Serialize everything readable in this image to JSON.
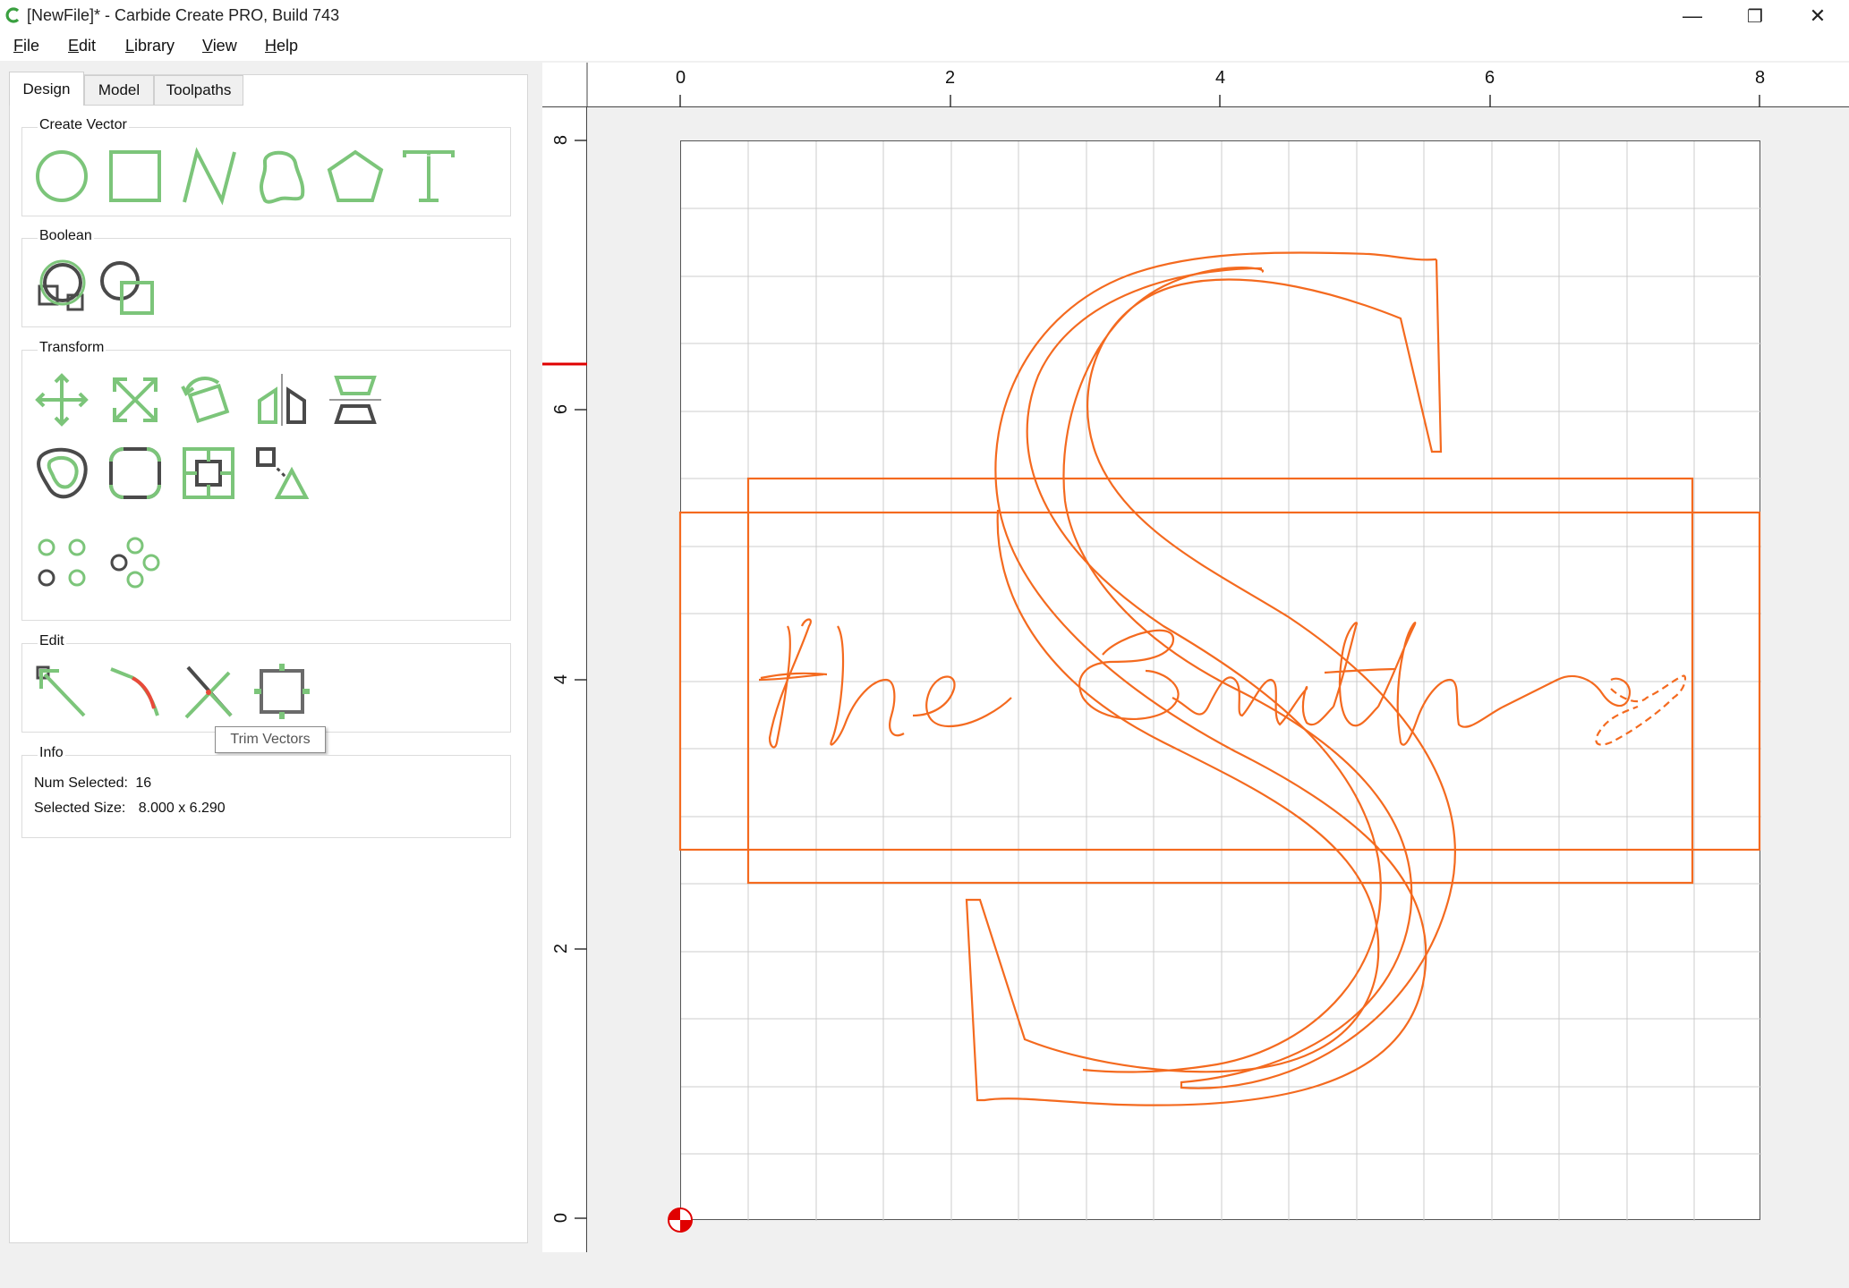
{
  "window": {
    "title": "[NewFile]* - Carbide Create PRO, Build 743",
    "controls": [
      "—",
      "❐",
      "✕"
    ]
  },
  "menu": [
    {
      "label": "File",
      "key": "F"
    },
    {
      "label": "Edit",
      "key": "E"
    },
    {
      "label": "Library",
      "key": "L"
    },
    {
      "label": "View",
      "key": "V"
    },
    {
      "label": "Help",
      "key": "H"
    }
  ],
  "tabs": [
    "Design",
    "Model",
    "Toolpaths"
  ],
  "groups": {
    "create_vector": {
      "title": "Create Vector",
      "tools": [
        "circle-icon",
        "rectangle-icon",
        "polyline-icon",
        "curve-icon",
        "polygon-icon",
        "text-icon"
      ]
    },
    "boolean": {
      "title": "Boolean",
      "tools": [
        "join-vectors-icon",
        "offset-vector-icon"
      ]
    },
    "transform": {
      "title": "Transform",
      "tools": [
        "move-icon",
        "scale-icon",
        "rotate-icon",
        "mirror-horizontal-icon",
        "mirror-vertical-icon",
        "offset-icon",
        "fillet-icon",
        "align-center-icon",
        "align-selected-icon",
        "array-grid-icon",
        "array-circular-icon"
      ]
    },
    "edit": {
      "title": "Edit",
      "tools": [
        "edit-nodes-icon",
        "smooth-curve-icon",
        "trim-vectors-icon",
        "bounding-box-icon"
      ]
    },
    "info": {
      "title": "Info",
      "num_selected_label": "Num Selected:",
      "num_selected_value": "16",
      "selected_size_label": "Selected Size:",
      "selected_size_value": "8.000 x 6.290"
    }
  },
  "tooltip": "Trim Vectors",
  "rulers": {
    "top": [
      "0",
      "2",
      "4",
      "6",
      "8"
    ],
    "left": [
      "8",
      "6",
      "4",
      "2",
      "0"
    ]
  },
  "colors": {
    "accent_green": "#7cc57a",
    "dark_gray": "#4a4a4a",
    "vector_orange": "#f46a1f",
    "grid_line": "#cccccc",
    "ruler_marker": "#e00000"
  }
}
